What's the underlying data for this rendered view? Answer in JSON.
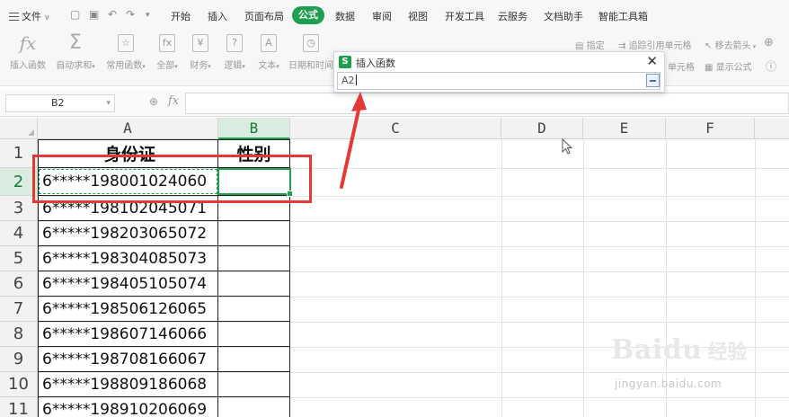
{
  "menubar": {
    "file": "文件",
    "quick_icons": [
      "save-icon",
      "print-icon",
      "undo-icon",
      "redo-icon",
      "more-icon"
    ],
    "tabs": [
      {
        "label": "开始"
      },
      {
        "label": "插入"
      },
      {
        "label": "页面布局"
      },
      {
        "label": "公式",
        "active": true
      },
      {
        "label": "数据"
      },
      {
        "label": "审阅"
      },
      {
        "label": "视图"
      },
      {
        "label": "开发工具"
      },
      {
        "label": "云服务"
      },
      {
        "label": "文档助手"
      },
      {
        "label": "智能工具箱"
      }
    ]
  },
  "ribbon": {
    "buttons": [
      {
        "label": "插入函数",
        "icon": "fx-icon"
      },
      {
        "label": "自动求和",
        "icon": "sum-icon"
      },
      {
        "label": "常用函数",
        "icon": "common-functions-icon"
      },
      {
        "label": "全部",
        "icon": "all-functions-icon"
      },
      {
        "label": "财务",
        "icon": "financial-icon"
      },
      {
        "label": "逻辑",
        "icon": "logical-icon"
      },
      {
        "label": "文本",
        "icon": "text-icon"
      },
      {
        "label": "日期和时间",
        "icon": "datetime-icon"
      }
    ],
    "right_items": {
      "define": "指定",
      "trace_precedents": "追踪引用单元格",
      "remove_arrows": "移去箭头",
      "trace_dependents": "单元格",
      "show_formulas": "显示公式"
    }
  },
  "formula_bar": {
    "name_box": "B2",
    "fx": "fx",
    "content": ""
  },
  "dialog": {
    "title": "插入函数",
    "input_value": "A2",
    "colors": {
      "accent": "#1e9e4f"
    }
  },
  "sheet": {
    "columns": [
      "A",
      "B",
      "C",
      "D",
      "E",
      "F"
    ],
    "row_numbers": [
      "1",
      "2",
      "3",
      "4",
      "5",
      "6",
      "7",
      "8",
      "9",
      "10",
      "11"
    ],
    "header": {
      "a": "身份证",
      "b": "性别"
    },
    "rows": [
      {
        "a": "6*****198001024060",
        "b": ""
      },
      {
        "a": "6*****198102045071",
        "b": ""
      },
      {
        "a": "6*****198203065072",
        "b": ""
      },
      {
        "a": "6*****198304085073",
        "b": ""
      },
      {
        "a": "6*****198405105074",
        "b": ""
      },
      {
        "a": "6*****198506126065",
        "b": ""
      },
      {
        "a": "6*****198607146066",
        "b": ""
      },
      {
        "a": "6*****198708166067",
        "b": ""
      },
      {
        "a": "6*****198809186068",
        "b": ""
      },
      {
        "a": "6*****198910206069",
        "b": ""
      }
    ],
    "selected_cell": "B2",
    "referenced_cell": "A2"
  },
  "watermark": {
    "brand": "Baidu",
    "brand_cn": "经验",
    "url": "jingyan.baidu.com"
  },
  "colors": {
    "accent": "#1e9e4f",
    "annotation": "#e53935"
  }
}
